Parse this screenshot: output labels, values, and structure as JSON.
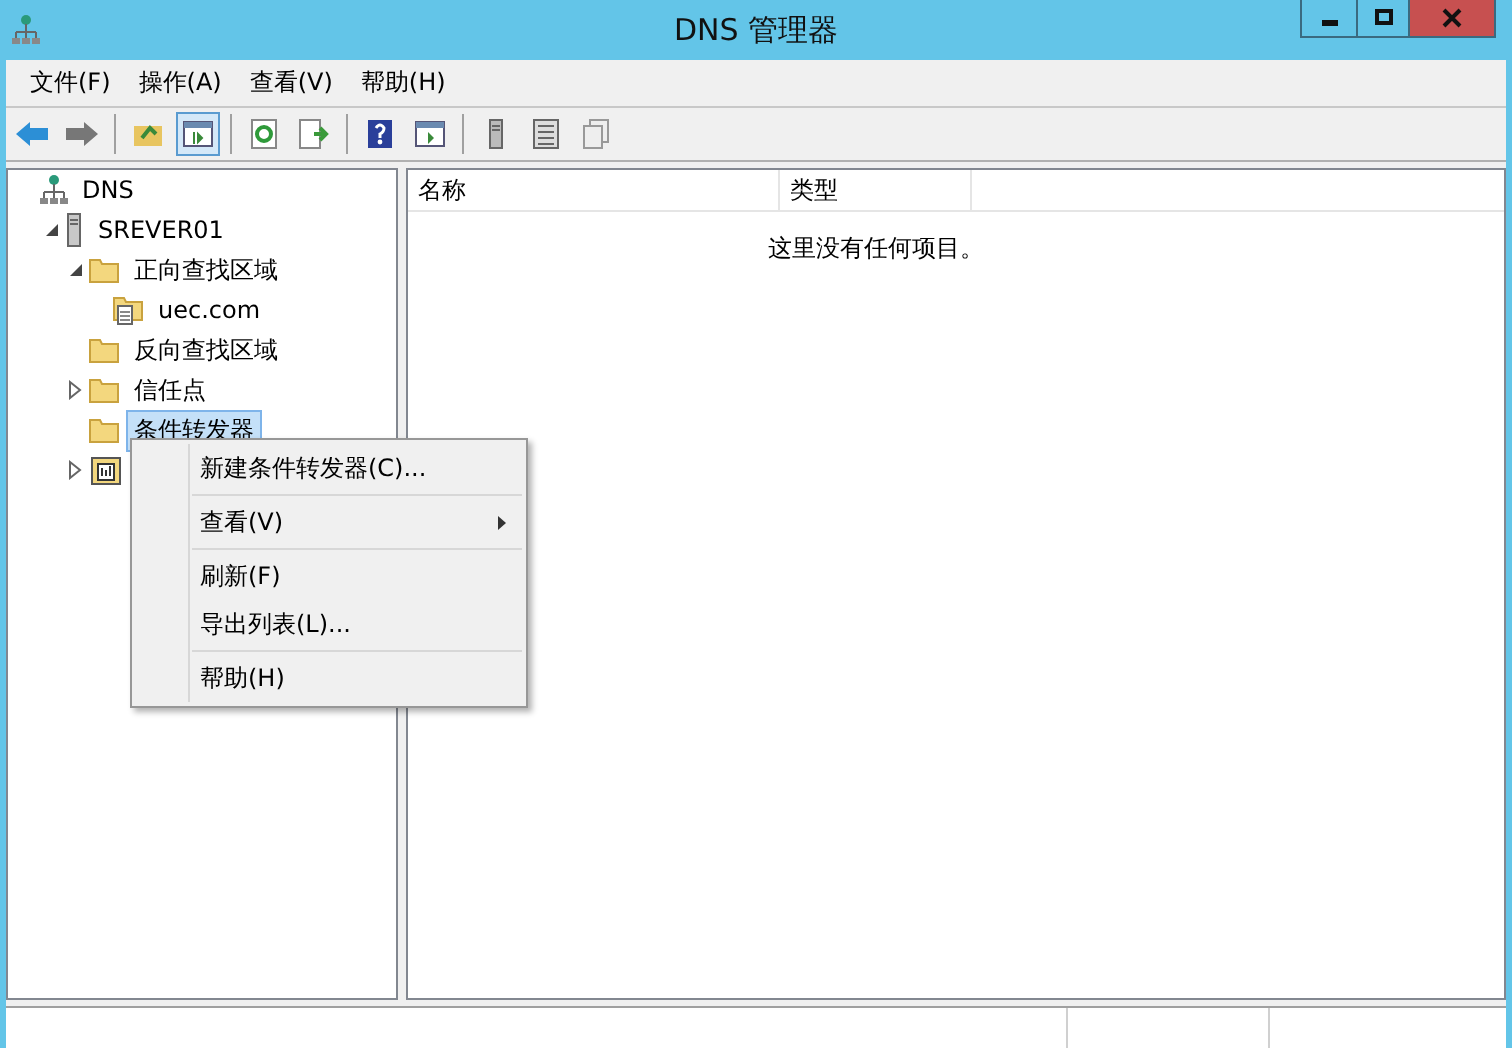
{
  "window": {
    "title": "DNS 管理器"
  },
  "menu_bar": [
    "文件(F)",
    "操作(A)",
    "查看(V)",
    "帮助(H)"
  ],
  "toolbar": [
    {
      "kind": "back",
      "pressed": false
    },
    {
      "kind": "forward",
      "pressed": false
    },
    {
      "kind": "separator"
    },
    {
      "kind": "up",
      "pressed": false
    },
    {
      "kind": "tree",
      "pressed": true
    },
    {
      "kind": "separator"
    },
    {
      "kind": "refresh",
      "pressed": false
    },
    {
      "kind": "export",
      "pressed": false
    },
    {
      "kind": "separator"
    },
    {
      "kind": "help",
      "pressed": false
    },
    {
      "kind": "pane",
      "pressed": false
    },
    {
      "kind": "separator"
    },
    {
      "kind": "server",
      "pressed": false
    },
    {
      "kind": "list",
      "pressed": false
    },
    {
      "kind": "copy",
      "pressed": false
    }
  ],
  "tree": [
    {
      "label": "DNS",
      "kind": "root",
      "selected": false,
      "children": [
        {
          "label": "SREVER01",
          "kind": "server",
          "expanded": true,
          "selected": false,
          "children": [
            {
              "label": "正向查找区域",
              "kind": "folder",
              "expanded": true,
              "selected": false,
              "children": [
                {
                  "label": "uec.com",
                  "kind": "zone",
                  "selected": false
                }
              ]
            },
            {
              "label": "反向查找区域",
              "kind": "folder",
              "selected": false
            },
            {
              "label": "信任点",
              "kind": "folder",
              "expanded": false,
              "selected": false
            },
            {
              "label": "条件转发器",
              "kind": "folder",
              "selected": true
            },
            {
              "kind": "log",
              "expanded": false,
              "selected": false
            }
          ]
        }
      ]
    }
  ],
  "list": {
    "columns": [
      "名称",
      "类型"
    ],
    "empty_message": "这里没有任何项目。"
  },
  "context_menu": [
    {
      "kind": "item",
      "label": "新建条件转发器(C)...",
      "submenu": false
    },
    {
      "kind": "separator"
    },
    {
      "kind": "item",
      "label": "查看(V)",
      "submenu": true
    },
    {
      "kind": "separator"
    },
    {
      "kind": "item",
      "label": "刷新(F)",
      "submenu": false
    },
    {
      "kind": "item",
      "label": "导出列表(L)...",
      "submenu": false
    },
    {
      "kind": "separator"
    },
    {
      "kind": "item",
      "label": "帮助(H)",
      "submenu": false
    }
  ]
}
